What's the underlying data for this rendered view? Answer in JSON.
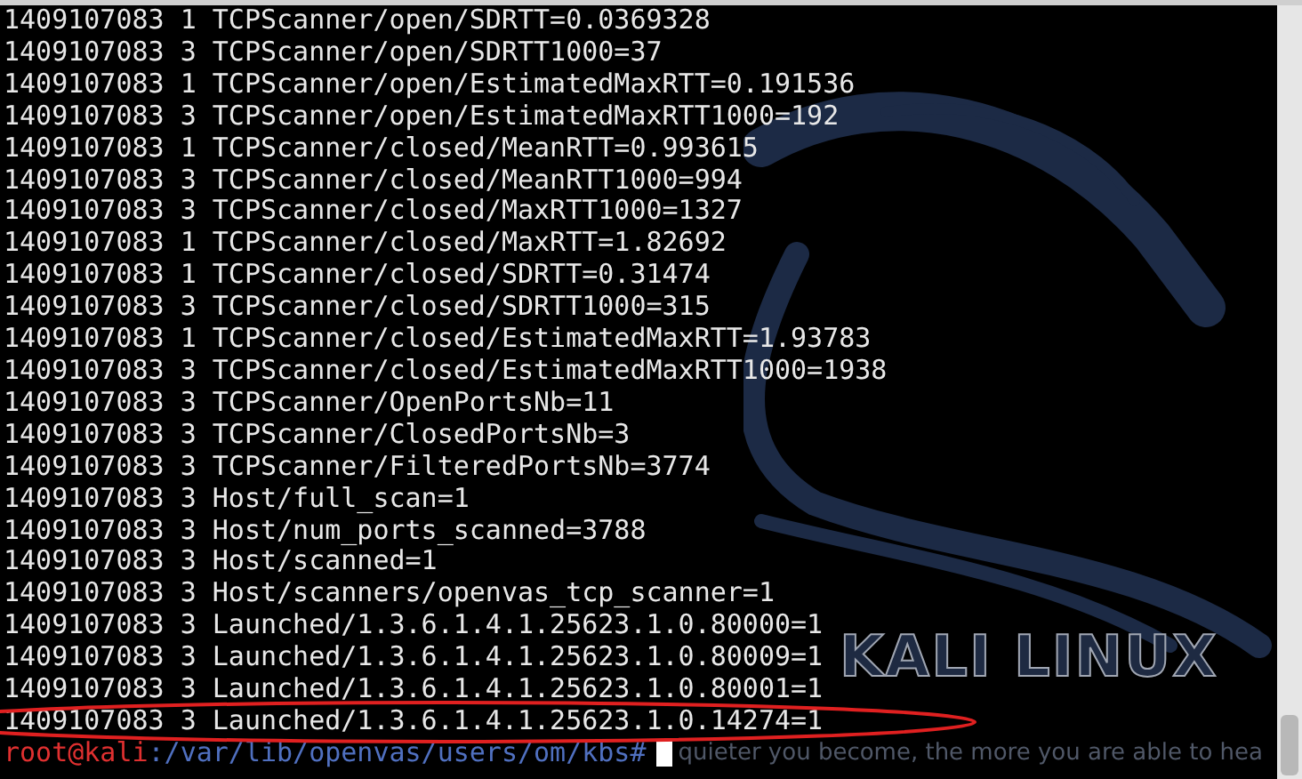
{
  "terminal": {
    "lines": [
      "1409107083 1 TCPScanner/open/SDRTT=0.0369328",
      "1409107083 3 TCPScanner/open/SDRTT1000=37",
      "1409107083 1 TCPScanner/open/EstimatedMaxRTT=0.191536",
      "1409107083 3 TCPScanner/open/EstimatedMaxRTT1000=192",
      "1409107083 1 TCPScanner/closed/MeanRTT=0.993615",
      "1409107083 3 TCPScanner/closed/MeanRTT1000=994",
      "1409107083 3 TCPScanner/closed/MaxRTT1000=1327",
      "1409107083 1 TCPScanner/closed/MaxRTT=1.82692",
      "1409107083 1 TCPScanner/closed/SDRTT=0.31474",
      "1409107083 3 TCPScanner/closed/SDRTT1000=315",
      "1409107083 1 TCPScanner/closed/EstimatedMaxRTT=1.93783",
      "1409107083 3 TCPScanner/closed/EstimatedMaxRTT1000=1938",
      "1409107083 3 TCPScanner/OpenPortsNb=11",
      "1409107083 3 TCPScanner/ClosedPortsNb=3",
      "1409107083 3 TCPScanner/FilteredPortsNb=3774",
      "1409107083 3 Host/full_scan=1",
      "1409107083 3 Host/num_ports_scanned=3788",
      "1409107083 3 Host/scanned=1",
      "1409107083 3 Host/scanners/openvas_tcp_scanner=1",
      "1409107083 3 Launched/1.3.6.1.4.1.25623.1.0.80000=1",
      "1409107083 3 Launched/1.3.6.1.4.1.25623.1.0.80009=1",
      "1409107083 3 Launched/1.3.6.1.4.1.25623.1.0.80001=1",
      "1409107083 3 Launched/1.3.6.1.4.1.25623.1.0.14274=1"
    ],
    "prompt": {
      "user_host": "root@kali",
      "path": ":/var/lib/openvas/users/om/kbs#"
    }
  },
  "wallpaper": {
    "logo": "KALI LINUX",
    "slogan": "quieter you become, the more you are able to hea"
  }
}
